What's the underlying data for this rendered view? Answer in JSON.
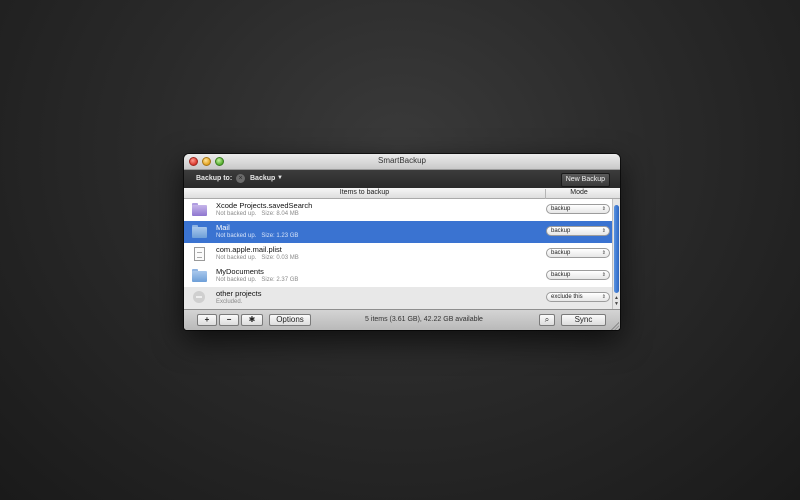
{
  "window": {
    "title": "SmartBackup"
  },
  "toolbar": {
    "backup_to_label": "Backup to:",
    "clear_icon": "x-circle-icon",
    "backup_target": "Backup",
    "new_backup_label": "New Backup"
  },
  "columns": {
    "items": "Items to backup",
    "mode": "Mode"
  },
  "items": [
    {
      "name": "Xcode Projects.savedSearch",
      "status": "Not backed up.",
      "size": "Size: 8.04 MB",
      "icon": "smart-folder-icon",
      "mode": "backup",
      "selected": false
    },
    {
      "name": "Mail",
      "status": "Not backed up.",
      "size": "Size: 1.23 GB",
      "icon": "folder-icon",
      "mode": "backup",
      "selected": true
    },
    {
      "name": "com.apple.mail.plist",
      "status": "Not backed up.",
      "size": "Size: 0.03 MB",
      "icon": "document-icon",
      "mode": "backup",
      "selected": false
    },
    {
      "name": "MyDocuments",
      "status": "Not backed up.",
      "size": "Size: 2.37 GB",
      "icon": "folder-icon",
      "mode": "backup",
      "selected": false
    },
    {
      "name": "other projects",
      "status": "Excluded.",
      "size": "",
      "icon": "excluded-icon",
      "mode": "exclude this",
      "selected": false
    }
  ],
  "bottombar": {
    "add_label": "+",
    "remove_label": "−",
    "gear_icon": "gear-icon",
    "options_label": "Options",
    "status_text": "5 items (3.61 GB), 42.22 GB available",
    "search_icon": "search-icon",
    "sync_label": "Sync"
  },
  "colors": {
    "selection": "#3a73d1",
    "toolbar_bg": "#333333"
  }
}
